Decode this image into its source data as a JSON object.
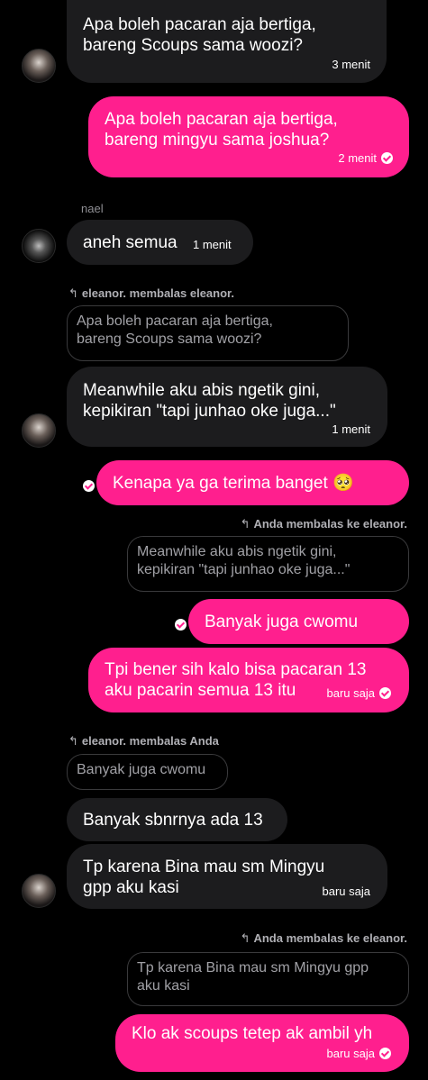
{
  "messages": [
    {
      "text": "Apa boleh pacaran aja bertiga,\nbareng Scoups sama woozi?",
      "time": "3 menit"
    },
    {
      "text": "Apa boleh pacaran aja bertiga,\nbareng mingyu sama joshua?",
      "time": "2 menit"
    },
    {
      "sender": "nael",
      "text": "aneh semua",
      "time": "1 menit"
    },
    {
      "reply_header": "eleanor. membalas eleanor.",
      "quote": "Apa boleh pacaran aja bertiga,\nbareng Scoups sama woozi?",
      "text": "Meanwhile aku abis ngetik gini,\nkepikiran \"tapi junhao oke juga...\"",
      "time": "1 menit"
    },
    {
      "text": "Kenapa ya ga terima banget 🥺"
    },
    {
      "reply_header": "Anda membalas ke eleanor.",
      "quote": "Meanwhile aku abis ngetik gini,\nkepikiran \"tapi junhao oke juga...\"",
      "text": "Banyak juga cwomu"
    },
    {
      "text": "Tpi bener sih kalo bisa pacaran 13\naku pacarin semua 13 itu",
      "time": "baru saja"
    },
    {
      "reply_header": "eleanor. membalas Anda",
      "quote": "Banyak juga cwomu",
      "text": "Banyak sbnrnya ada 13"
    },
    {
      "text": "Tp karena Bina mau sm Mingyu\ngpp aku kasi",
      "time": "baru saja"
    },
    {
      "reply_header": "Anda membalas ke eleanor.",
      "quote": "Tp karena Bina mau sm Mingyu gpp\naku kasi",
      "text": "Klo ak scoups tetep ak ambil yh",
      "time": "baru saja"
    }
  ],
  "icons": {
    "reply": "reply-arrow-icon",
    "read": "read-check-icon",
    "avatar": "avatar"
  },
  "colors": {
    "background": "#000000",
    "incoming": "#1c1c1e",
    "outgoing": "#ff1f8e"
  }
}
